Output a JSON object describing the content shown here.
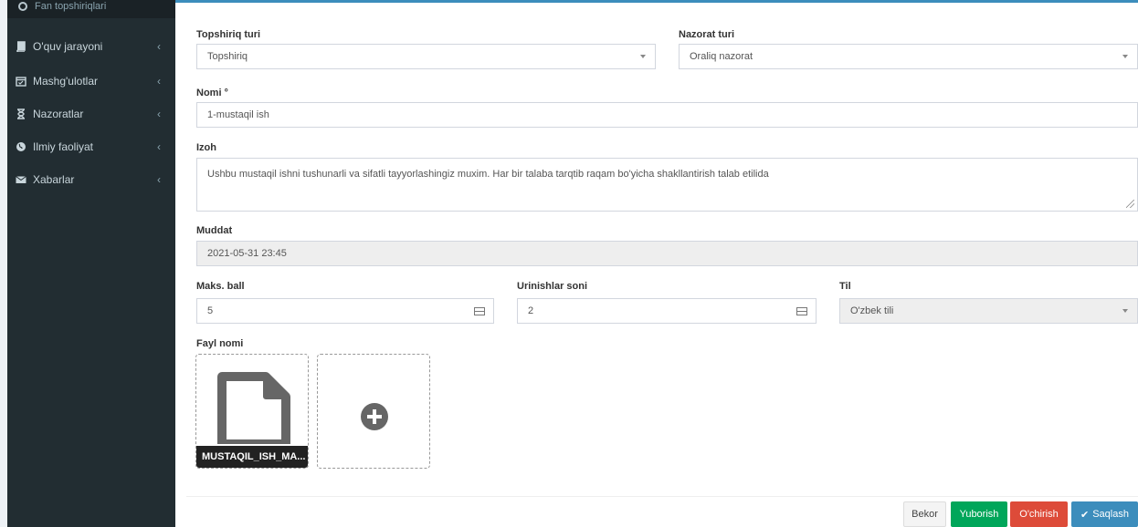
{
  "sidebar": {
    "top_item": "Fan topshiriqlari",
    "items": [
      {
        "label": "O'quv jarayoni",
        "icon": "book-icon"
      },
      {
        "label": "Mashg'ulotlar",
        "icon": "calendar-icon"
      },
      {
        "label": "Nazoratlar",
        "icon": "hourglass-icon"
      },
      {
        "label": "Ilmiy faoliyat",
        "icon": "globe-icon"
      },
      {
        "label": "Xabarlar",
        "icon": "envelope-icon"
      }
    ]
  },
  "form": {
    "topshiriq_turi": {
      "label": "Topshiriq turi",
      "value": "Topshiriq"
    },
    "nazorat_turi": {
      "label": "Nazorat turi",
      "value": "Oraliq nazorat"
    },
    "nomi": {
      "label": "Nomi °",
      "value": "1-mustaqil ish"
    },
    "izoh": {
      "label": "Izoh",
      "value": "Ushbu mustaqil ishni tushunarli va sifatli tayyorlashingiz muxim. Har bir talaba tarqtib raqam bo'yicha shakllantirish talab etilida"
    },
    "muddat": {
      "label": "Muddat",
      "value": "2021-05-31 23:45"
    },
    "maks_ball": {
      "label": "Maks. ball",
      "value": "5"
    },
    "urinishlar_soni": {
      "label": "Urinishlar soni",
      "value": "2"
    },
    "til": {
      "label": "Til",
      "value": "O'zbek tili"
    },
    "fayl": {
      "label": "Fayl nomi",
      "file_name": "MUSTAQIL_ISH_MA..."
    }
  },
  "buttons": {
    "bekor": "Bekor",
    "yuborish": "Yuborish",
    "ochirish": "O'chirish",
    "saqlash": "Saqlash"
  },
  "colors": {
    "sidebar_bg": "#222d32",
    "accent_blue": "#3c8dbc",
    "green": "#00a65a",
    "red": "#dd4b39"
  }
}
